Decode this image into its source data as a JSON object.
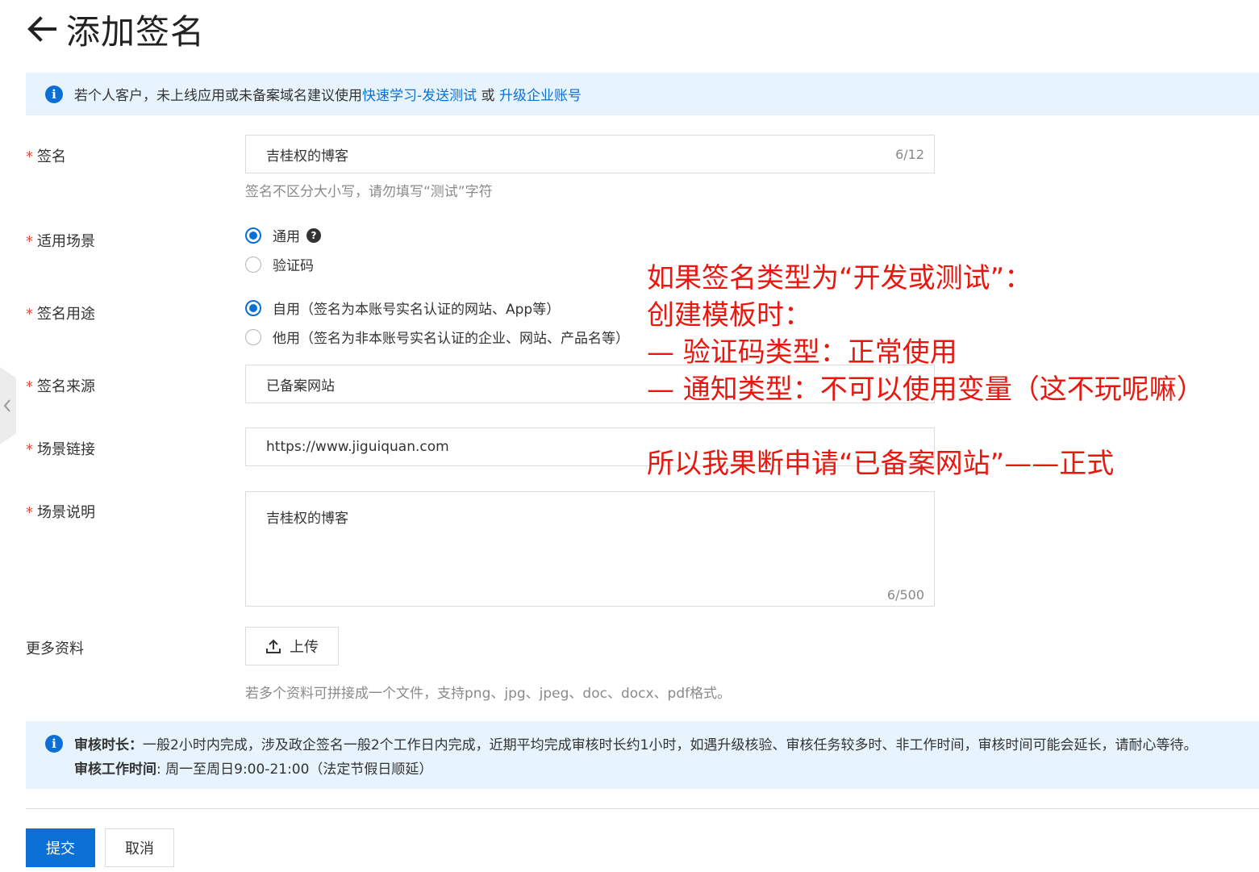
{
  "header": {
    "title": "添加签名"
  },
  "top_notice": {
    "text": "若个人客户，未上线应用或未备案域名建议使用",
    "link1": "快速学习-发送测试",
    "sep": " 或 ",
    "link2": "升级企业账号"
  },
  "form": {
    "required_mark": "*",
    "signature": {
      "label": "签名",
      "value": "吉桂权的博客",
      "counter": "6/12",
      "hint": "签名不区分大小写，请勿填写“测试”字符"
    },
    "scenario": {
      "label": "适用场景",
      "options": [
        {
          "label": "通用",
          "checked": true
        },
        {
          "label": "验证码",
          "checked": false
        }
      ]
    },
    "purpose": {
      "label": "签名用途",
      "options": [
        {
          "label": "自用（签名为本账号实名认证的网站、App等）",
          "checked": true
        },
        {
          "label": "他用（签名为非本账号实名认证的企业、网站、产品名等）",
          "checked": false
        }
      ]
    },
    "source": {
      "label": "签名来源",
      "value": "已备案网站"
    },
    "link": {
      "label": "场景链接",
      "value": "https://www.jiguiquan.com"
    },
    "description": {
      "label": "场景说明",
      "value": "吉桂权的博客",
      "counter": "6/500"
    },
    "more": {
      "label": "更多资料",
      "upload_label": "上传",
      "hint": "若多个资料可拼接成一个文件，支持png、jpg、jpeg、doc、docx、pdf格式。"
    }
  },
  "bottom_notice": {
    "line1_title": "审核时长：",
    "line1_text": "一般2小时内完成，涉及政企签名一般2个工作日内完成，近期平均完成审核时长约1小时，如遇升级核验、审核任务较多时、非工作时间，审核时间可能会延长，请耐心等待。",
    "line2_title": "审核工作时间",
    "line2_text": ": 周一至周日9:00-21:00（法定节假日顺延）"
  },
  "actions": {
    "submit": "提交",
    "cancel": "取消"
  },
  "annotation": {
    "lines": [
      "如果签名类型为“开发或测试”：",
      "创建模板时：",
      "— 验证码类型：正常使用",
      "— 通知类型：不可以使用变量（这不玩呢嘛）",
      "所以我果断申请“已备案网站”——正式"
    ]
  },
  "colors": {
    "primary": "#0a70d6",
    "notice_bg": "#e7f4fd",
    "required": "#e5493a",
    "annotation": "#e8170f"
  },
  "icons": [
    "back-arrow-icon",
    "info-icon",
    "help-icon",
    "upload-icon",
    "chevron-left-icon"
  ]
}
